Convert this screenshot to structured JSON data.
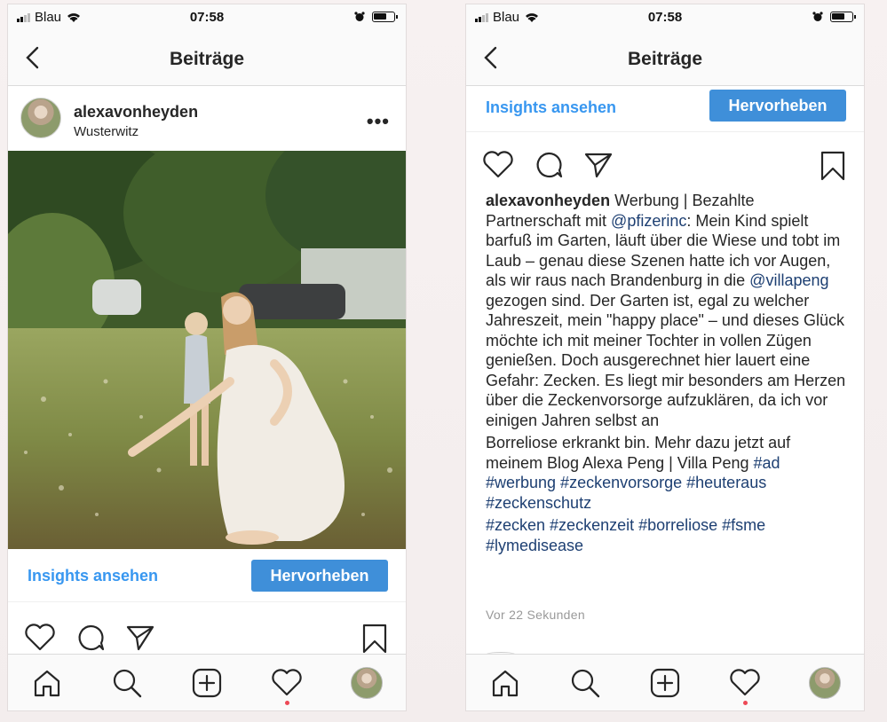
{
  "status_bar": {
    "carrier": "Blau",
    "time": "07:58"
  },
  "header": {
    "title": "Beiträge"
  },
  "post": {
    "username": "alexavonheyden",
    "location": "Wusterwitz",
    "insights_label": "Insights ansehen",
    "highlight_label": "Hervorheben",
    "caption": {
      "username": "alexavonheyden",
      "part1": " Werbung | Bezahlte Partnerschaft mit ",
      "mention1": "@pfizerinc",
      "part2": ": Mein Kind spielt barfuß im Garten, läuft über die Wiese und tobt im Laub – genau diese Szenen hatte ich vor Augen, als wir raus nach Brandenburg in die ",
      "mention2": "@villapeng",
      "part3": " gezogen sind. Der Garten ist, egal zu welcher Jahreszeit, mein \"happy place\" – und dieses Glück möchte ich mit meiner Tochter in vollen Zügen genießen. Doch ausgerechnet hier lauert eine Gefahr: Zecken. Es liegt mir besonders am Herzen über die Zeckenvorsorge aufzuklären, da ich vor einigen Jahren selbst an",
      "part4": "Borreliose erkrankt bin. Mehr dazu jetzt auf meinem Blog Alexa Peng | Villa Peng ",
      "tags_line1": "#ad #werbung #zeckenvorsorge #heuteraus #zeckenschutz",
      "tags_line2": "#zecken #zeckenzeit #borreliose #fsme #lymedisease"
    },
    "timestamp": "Vor 22 Sekunden"
  },
  "tabs": [
    "home-icon",
    "search-icon",
    "add-icon",
    "heart-icon",
    "profile-avatar"
  ],
  "colors": {
    "link": "#3897f0",
    "button": "#3f8fd9",
    "hashtag": "#1d3f72",
    "notification_dot": "#ed4956"
  }
}
